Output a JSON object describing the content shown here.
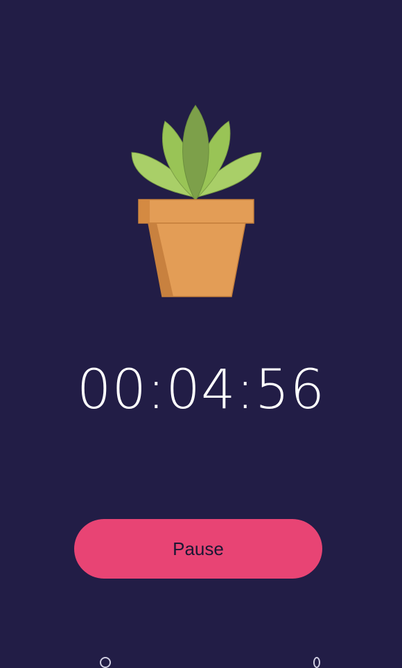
{
  "timer": {
    "display": "00:04:56"
  },
  "controls": {
    "pause_label": "Pause"
  },
  "illustration": {
    "icon": "potted-plant-icon"
  },
  "colors": {
    "background": "#221d46",
    "button": "#e84474",
    "pot": "#e39d56",
    "leaves": "#9cc75b"
  }
}
